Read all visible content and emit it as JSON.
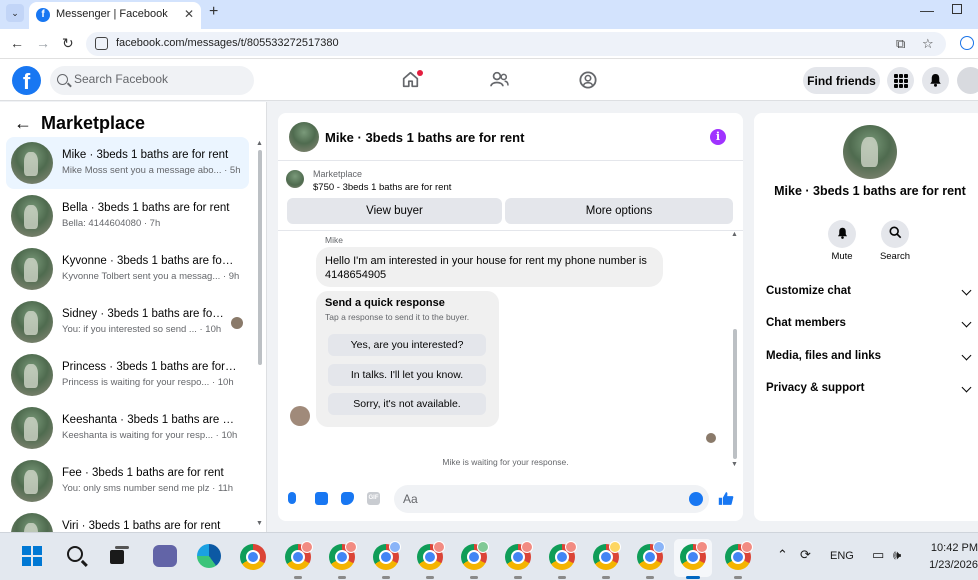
{
  "browser": {
    "tab_title": "Messenger | Facebook",
    "url": "facebook.com/messages/t/805533272517380"
  },
  "header": {
    "search_placeholder": "Search Facebook",
    "find_friends": "Find friends"
  },
  "sidebar": {
    "title": "Marketplace",
    "conversations": [
      {
        "name": "Mike · 3beds 1 baths are for rent",
        "preview": "Mike Moss sent you a message abo... · 5h",
        "active": true
      },
      {
        "name": "Bella · 3beds 1 baths are for rent",
        "preview": "Bella: 4144604080 · 7h"
      },
      {
        "name": "Kyvonne · 3beds 1 baths are for ...",
        "preview": "Kyvonne Tolbert sent you a messag... · 9h"
      },
      {
        "name": "Sidney · 3beds 1 baths are for ...",
        "preview": "You: if you interested so send ... · 10h"
      },
      {
        "name": "Princess · 3beds 1 baths are for r...",
        "preview": "Princess is waiting for your respo... · 10h"
      },
      {
        "name": "Keeshanta · 3beds 1 baths are fo...",
        "preview": "Keeshanta is waiting for your resp... · 10h"
      },
      {
        "name": "Fee · 3beds 1 baths are for rent",
        "preview": "You: only sms number send me plz · 11h"
      },
      {
        "name": "Viri · 3beds 1 baths are for rent",
        "preview": ""
      }
    ]
  },
  "chat": {
    "title": "Mike · 3beds 1 baths are for rent",
    "marketplace_label": "Marketplace",
    "listing": "$750 - 3beds 1 baths are for rent",
    "view_buyer": "View buyer",
    "more_options": "More options",
    "sender": "Mike",
    "message": "Hello I'm am interested in your house for rent my phone number is 4148654905",
    "quick_title": "Send a quick response",
    "quick_subtitle": "Tap a response to send it to the buyer.",
    "quick_options": [
      "Yes, are you interested?",
      "In talks. I'll let you know.",
      "Sorry, it's not available."
    ],
    "waiting": "Mike is waiting for your response.",
    "composer_placeholder": "Aa",
    "gif_label": "GIF"
  },
  "right_panel": {
    "name": "Mike · 3beds 1 baths are for rent",
    "mute": "Mute",
    "search": "Search",
    "sections": [
      "Customize chat",
      "Chat members",
      "Media, files and links",
      "Privacy & support"
    ]
  },
  "taskbar": {
    "language": "ENG",
    "time": "10:42 PM",
    "date": "1/23/2026"
  },
  "colors": {
    "facebook_blue": "#1877f2",
    "active_conversation": "#ebf5ff",
    "info_purple": "#a033ff"
  }
}
